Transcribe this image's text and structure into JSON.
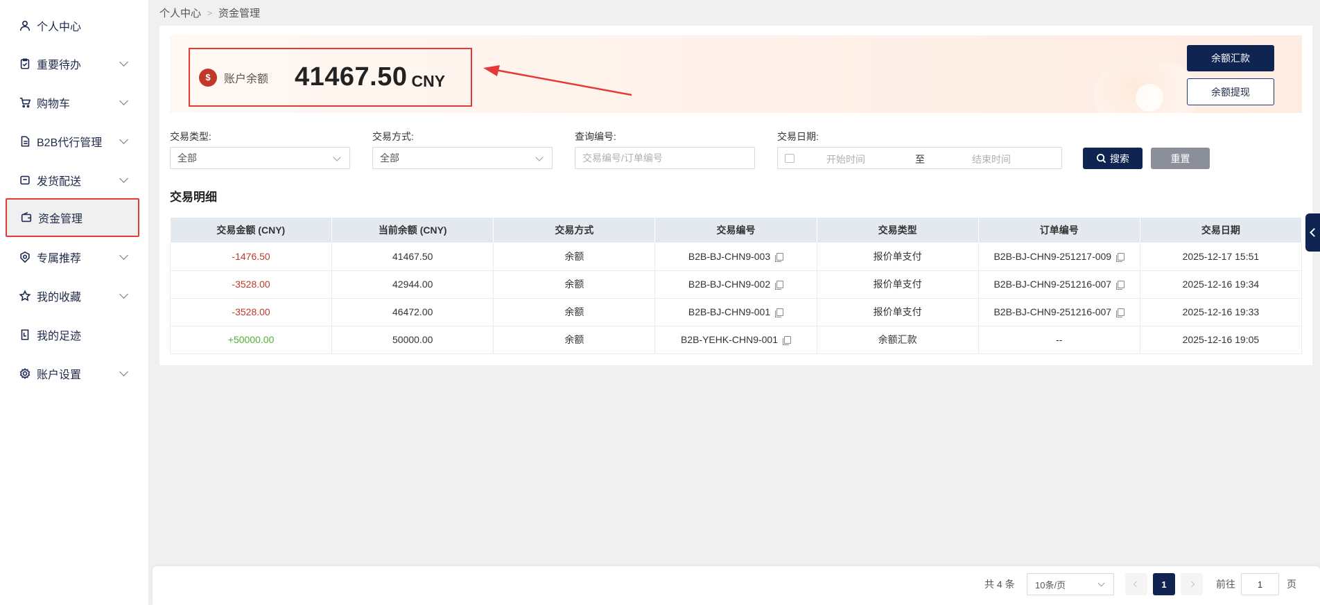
{
  "sidebar": {
    "items": [
      {
        "label": "个人中心",
        "icon": "user-icon",
        "has_children": false
      },
      {
        "label": "重要待办",
        "icon": "clipboard-check-icon",
        "has_children": true
      },
      {
        "label": "购物车",
        "icon": "cart-icon",
        "has_children": true
      },
      {
        "label": "B2B代行管理",
        "icon": "document-icon",
        "has_children": true
      },
      {
        "label": "发货配送",
        "icon": "box-icon",
        "has_children": true
      },
      {
        "label": "资金管理",
        "icon": "wallet-icon",
        "has_children": false,
        "active": true
      },
      {
        "label": "专属推荐",
        "icon": "badge-icon",
        "has_children": true
      },
      {
        "label": "我的收藏",
        "icon": "star-icon",
        "has_children": true
      },
      {
        "label": "我的足迹",
        "icon": "footprint-icon",
        "has_children": false
      },
      {
        "label": "账户设置",
        "icon": "gear-icon",
        "has_children": true
      }
    ]
  },
  "breadcrumb": {
    "root": "个人中心",
    "separator": ">",
    "current": "资金管理"
  },
  "balance": {
    "label": "账户余额",
    "value": "41467.50",
    "unit": "CNY",
    "bag_glyph": "$",
    "remit_button": "余额汇款",
    "withdraw_button": "余额提现"
  },
  "filters": {
    "type_label": "交易类型:",
    "type_value": "全部",
    "method_label": "交易方式:",
    "method_value": "全部",
    "query_label": "查询编号:",
    "query_placeholder": "交易编号/订单编号",
    "date_label": "交易日期:",
    "date_start_placeholder": "开始时间",
    "date_to": "至",
    "date_end_placeholder": "结束时间",
    "search_button": "搜索",
    "reset_button": "重置"
  },
  "section_title": "交易明细",
  "table": {
    "headers": [
      "交易金额 (CNY)",
      "当前余额 (CNY)",
      "交易方式",
      "交易编号",
      "交易类型",
      "订单编号",
      "交易日期"
    ],
    "rows": [
      {
        "amount": "-1476.50",
        "sign": "neg",
        "balance": "41467.50",
        "method": "余额",
        "tx_no": "B2B-BJ-CHN9-003",
        "type": "报价单支付",
        "order_no": "B2B-BJ-CHN9-251217-009",
        "order_copy": true,
        "date": "2025-12-17 15:51"
      },
      {
        "amount": "-3528.00",
        "sign": "neg",
        "balance": "42944.00",
        "method": "余额",
        "tx_no": "B2B-BJ-CHN9-002",
        "type": "报价单支付",
        "order_no": "B2B-BJ-CHN9-251216-007",
        "order_copy": true,
        "date": "2025-12-16 19:34"
      },
      {
        "amount": "-3528.00",
        "sign": "neg",
        "balance": "46472.00",
        "method": "余额",
        "tx_no": "B2B-BJ-CHN9-001",
        "type": "报价单支付",
        "order_no": "B2B-BJ-CHN9-251216-007",
        "order_copy": true,
        "date": "2025-12-16 19:33"
      },
      {
        "amount": "+50000.00",
        "sign": "pos",
        "balance": "50000.00",
        "method": "余额",
        "tx_no": "B2B-YEHK-CHN9-001",
        "type": "余额汇款",
        "order_no": "--",
        "order_copy": false,
        "date": "2025-12-16 19:05"
      }
    ]
  },
  "pagination": {
    "total_text": "共 4 条",
    "page_size": "10条/页",
    "current_page": "1",
    "goto_label": "前往",
    "goto_value": "1",
    "page_suffix": "页"
  },
  "colors": {
    "primary": "#0f2451",
    "highlight_border": "#e53935",
    "negative": "#c0392b",
    "positive": "#52b033"
  }
}
